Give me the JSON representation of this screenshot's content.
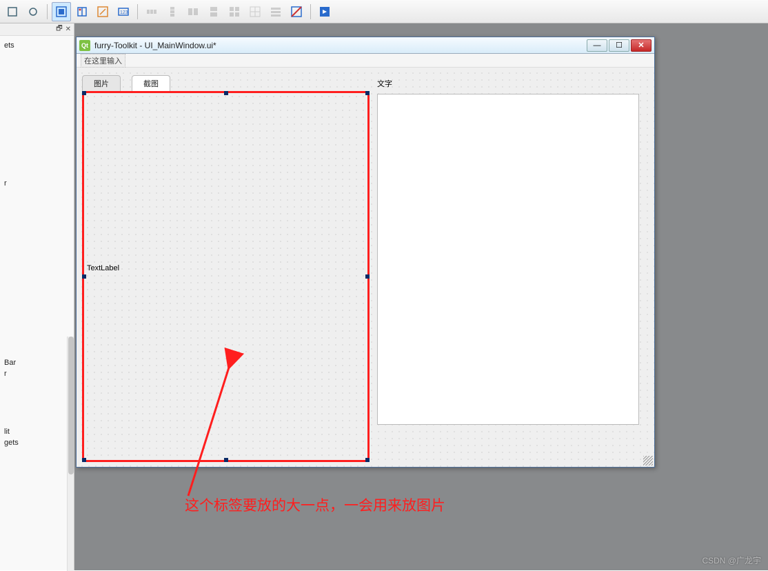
{
  "toolbar": {
    "buttons": [
      {
        "name": "edit-widgets-icon",
        "disabled": false
      },
      {
        "name": "edit-signals-icon",
        "disabled": false
      },
      {
        "sep": true
      },
      {
        "name": "layout-grid-icon",
        "active": true
      },
      {
        "name": "layout-form-icon",
        "disabled": false
      },
      {
        "name": "layout-break-icon",
        "disabled": false
      },
      {
        "name": "layout-adjust-icon",
        "disabled": false
      },
      {
        "sep": true
      },
      {
        "name": "hbox-icon",
        "disabled": true
      },
      {
        "name": "vbox-icon",
        "disabled": true
      },
      {
        "name": "hsplit-icon",
        "disabled": true
      },
      {
        "name": "vsplit-icon",
        "disabled": true
      },
      {
        "name": "grid-icon",
        "disabled": true
      },
      {
        "name": "grid2-icon",
        "disabled": true
      },
      {
        "name": "form2-icon",
        "disabled": true
      },
      {
        "name": "break2-icon",
        "disabled": false
      },
      {
        "sep": true
      },
      {
        "name": "preview-icon",
        "disabled": false
      }
    ]
  },
  "left_panel": {
    "items": [
      "ets",
      " ",
      "r",
      "",
      "Bar",
      "r",
      "",
      "",
      "lit",
      "gets"
    ]
  },
  "designer": {
    "title": "furry-Toolkit - UI_MainWindow.ui*",
    "menubar_hint": "在这里输入",
    "tabs": [
      "图片",
      "截图"
    ],
    "active_tab": 1,
    "label_text": "TextLabel",
    "text_label": "文字"
  },
  "annotation": {
    "text": "这个标签要放的大一点，一会用来放图片"
  },
  "watermark": "CSDN @广龙宇"
}
